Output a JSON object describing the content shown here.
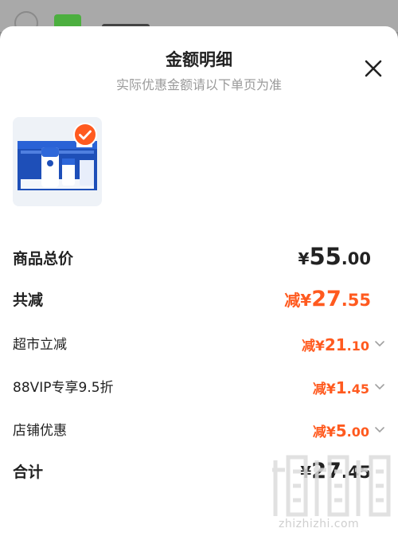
{
  "header": {
    "title": "金额明细",
    "subtitle": "实际优惠金额请以下单页为准"
  },
  "product": {
    "image_icon": "product-milk-box-image",
    "selected_icon": "check-badge-icon"
  },
  "summary": {
    "total": {
      "label": "商品总价",
      "currency": "¥",
      "integer": "55",
      "decimal": ".00"
    },
    "discount": {
      "label": "共减",
      "prefix": "减¥",
      "integer": "27",
      "decimal": ".55"
    },
    "items": [
      {
        "label": "超市立减",
        "prefix": "减¥",
        "integer": "21",
        "decimal": ".10"
      },
      {
        "label": "88VIP专享9.5折",
        "prefix": "减¥",
        "integer": "1",
        "decimal": ".45"
      },
      {
        "label": "店铺优惠",
        "prefix": "减¥",
        "integer": "5",
        "decimal": ".00"
      }
    ],
    "grand": {
      "label": "合计",
      "currency": "¥",
      "integer": "27",
      "decimal": ".45"
    }
  },
  "watermark": {
    "text": "zhizhizhi.com"
  },
  "colors": {
    "accent": "#ff5a1f",
    "text": "#222222",
    "muted": "#9a9a9a"
  }
}
